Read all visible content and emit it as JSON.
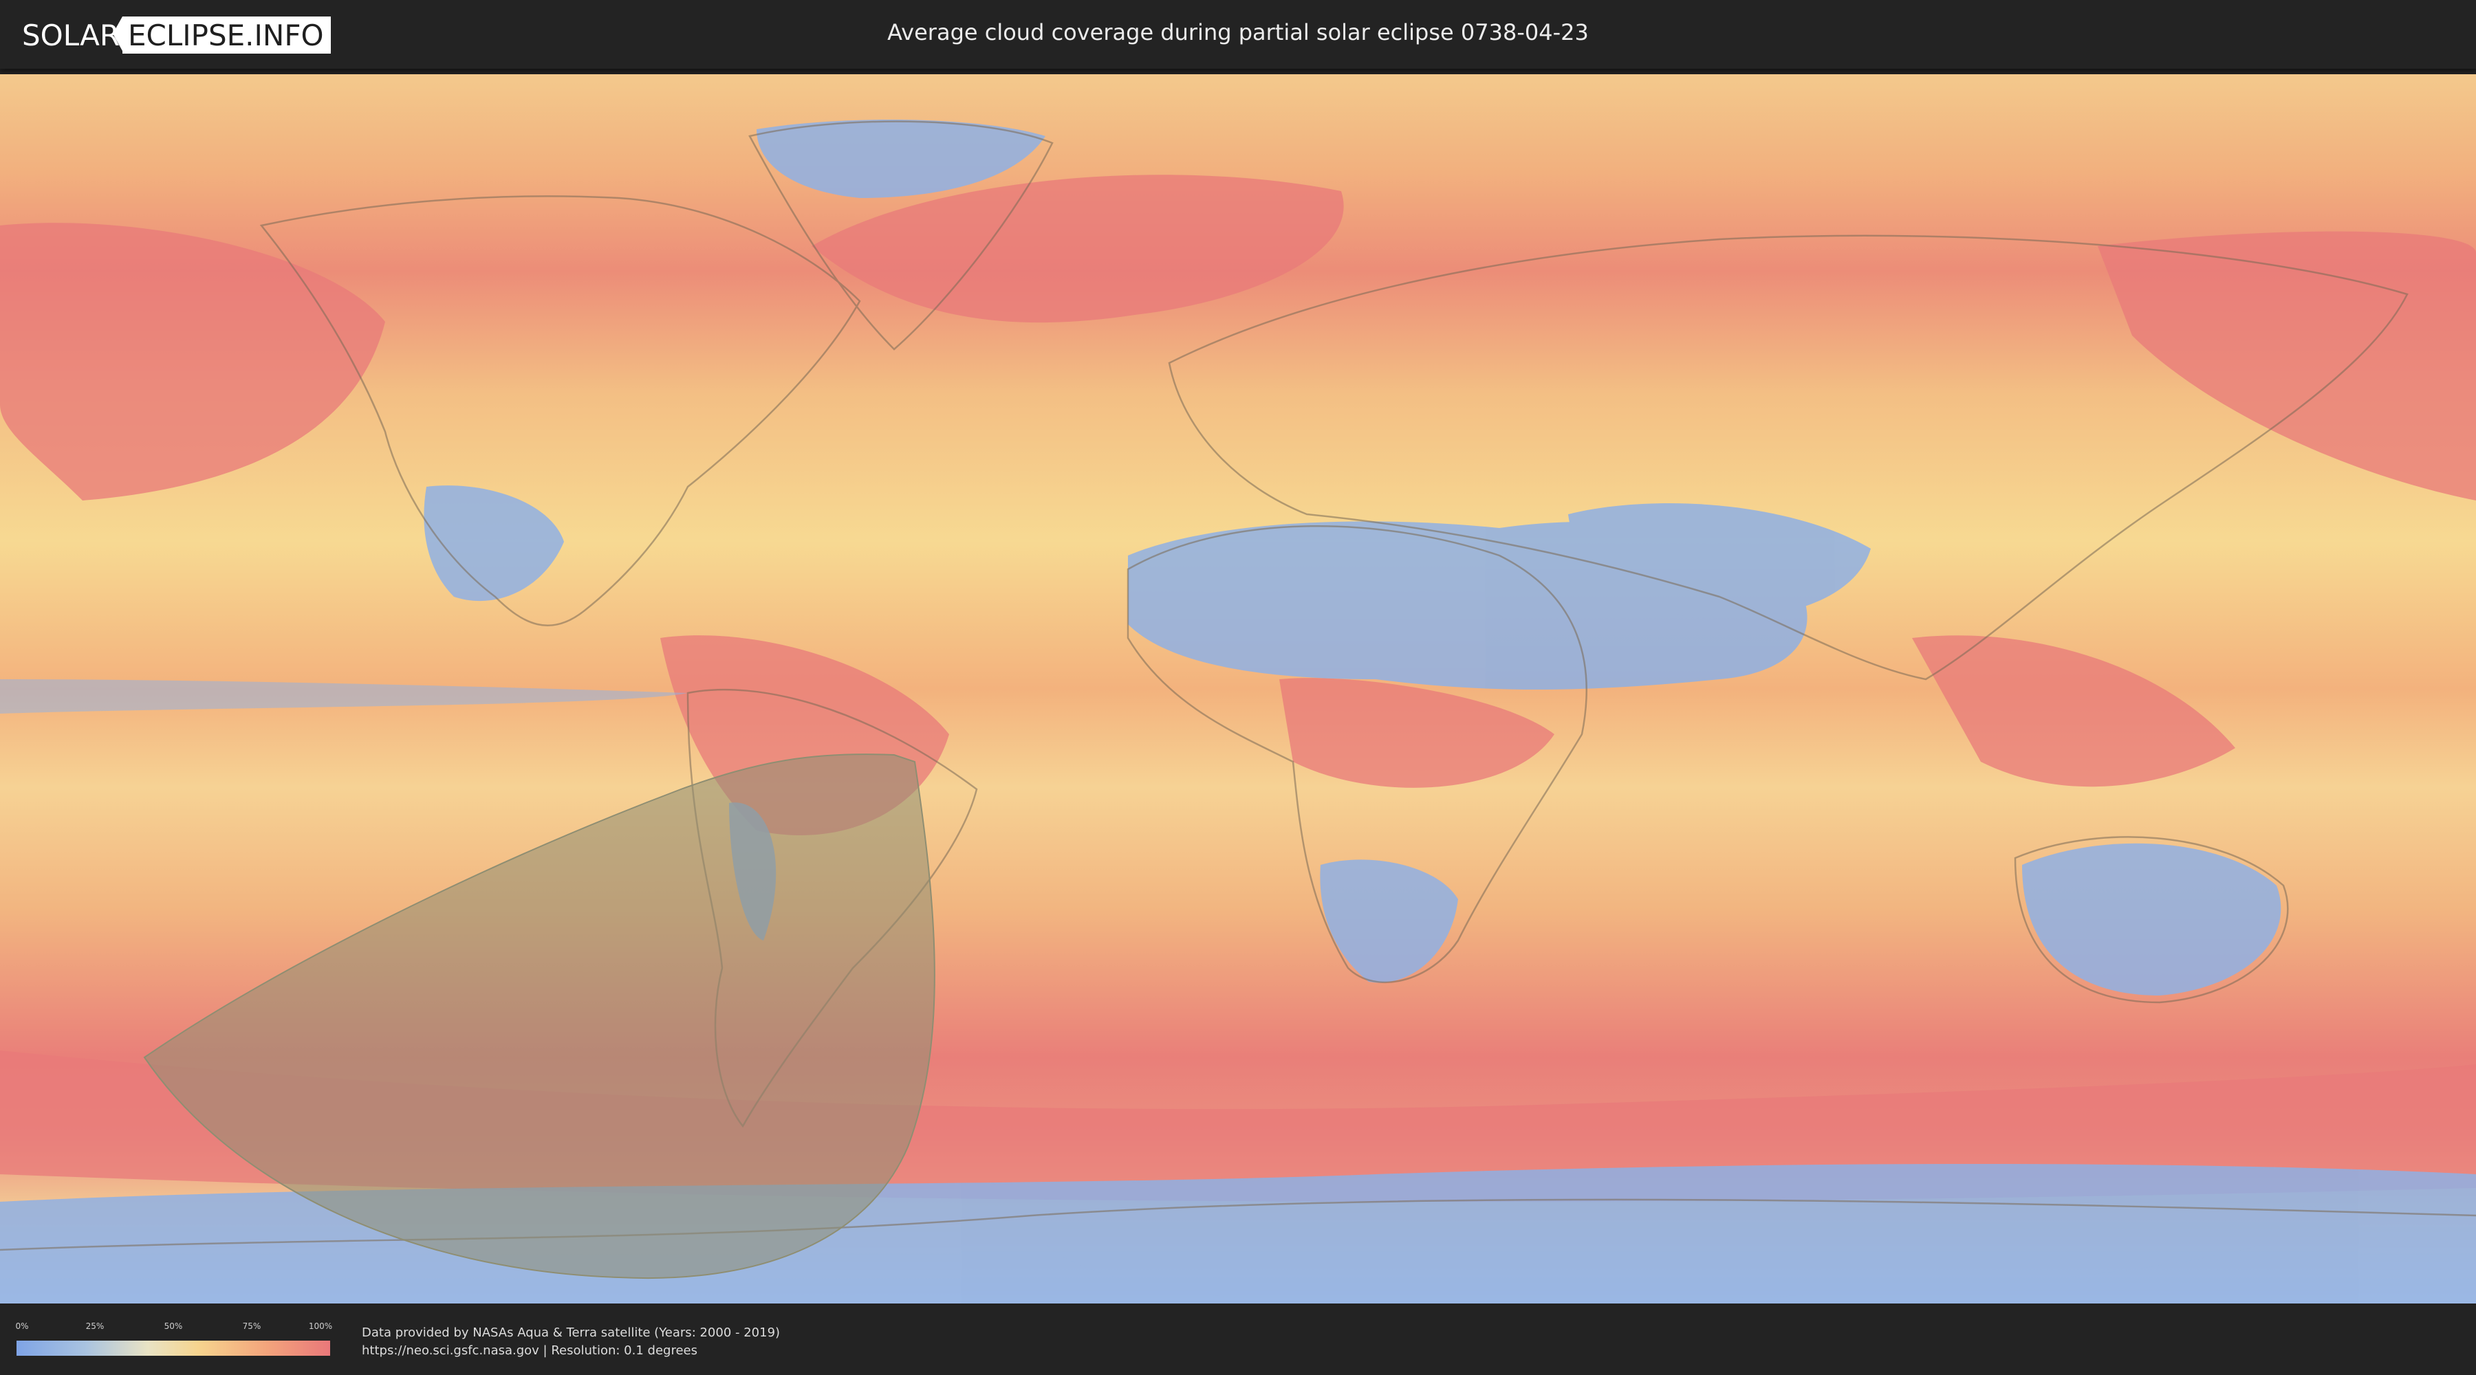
{
  "header": {
    "logo_part1": "SOLAR",
    "logo_part2": "ECLIPSE.INFO",
    "title": "Average cloud coverage during partial solar eclipse 0738-04-23"
  },
  "map": {
    "type": "cloud-coverage-world-map",
    "eclipse_region_fill": "#8f8e72",
    "cloud_color_low": "#7fa4e6",
    "cloud_color_mid": "#f6d48e",
    "cloud_color_high": "#e9787a"
  },
  "legend": {
    "ticks": [
      "0%",
      "25%",
      "50%",
      "75%",
      "100%"
    ]
  },
  "credits": {
    "line1": "Data provided by NASAs Aqua & Terra satellite (Years: 2000 - 2019)",
    "line2": "https://neo.sci.gsfc.nasa.gov | Resolution: 0.1 degrees"
  }
}
